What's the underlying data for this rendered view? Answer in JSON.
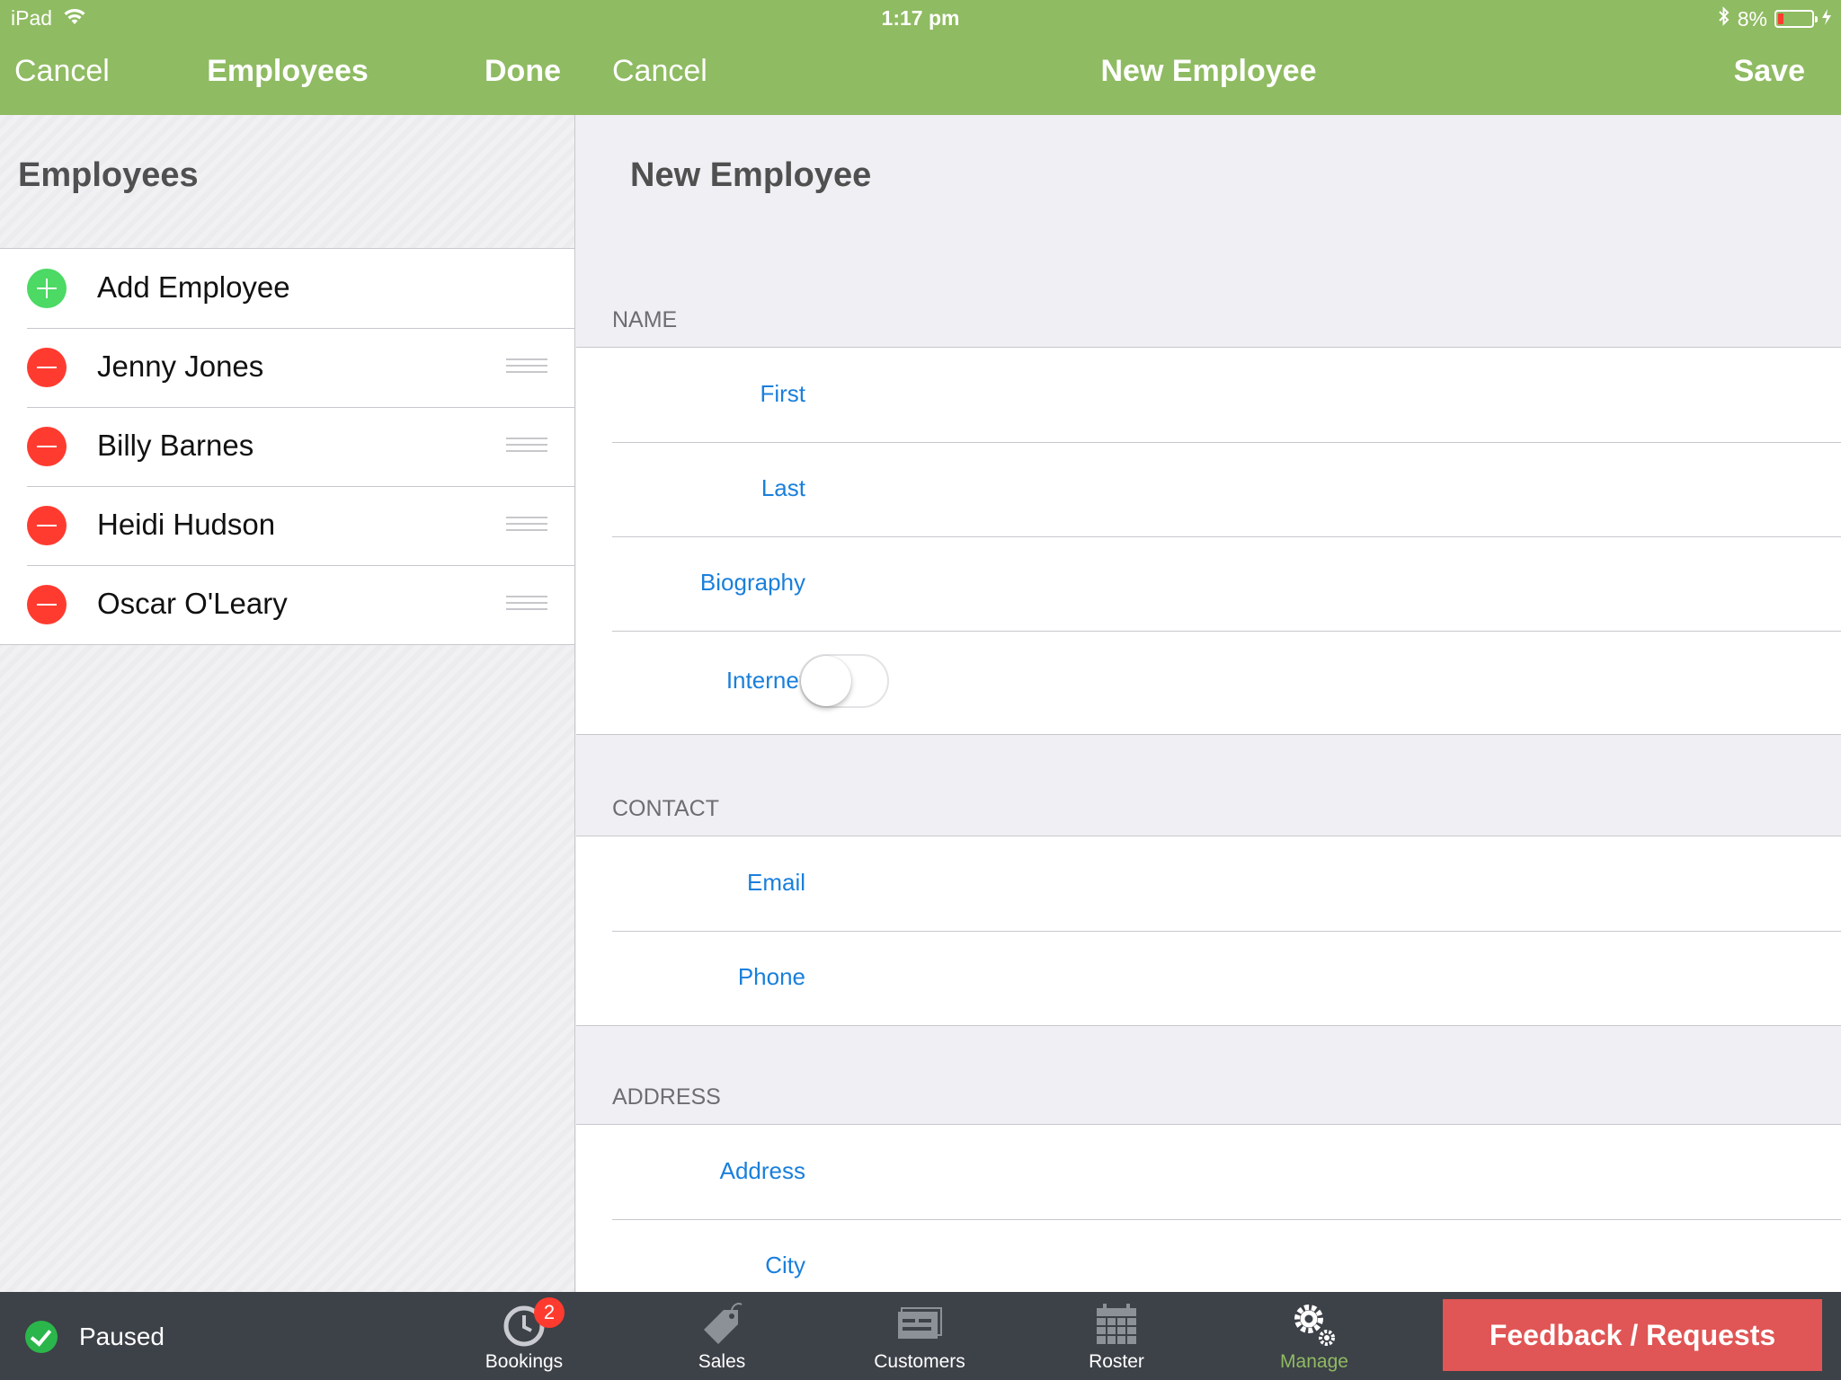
{
  "status_bar": {
    "device": "iPad",
    "time": "1:17 pm",
    "battery_percent": "8%",
    "battery_level": 0.08
  },
  "left_nav": {
    "cancel_label": "Cancel",
    "title": "Employees",
    "done_label": "Done"
  },
  "right_nav": {
    "cancel_label": "Cancel",
    "title": "New Employee",
    "save_label": "Save"
  },
  "employees_panel": {
    "heading": "Employees",
    "add_label": "Add Employee",
    "employees": [
      "Jenny Jones",
      "Billy Barnes",
      "Heidi Hudson",
      "Oscar O'Leary"
    ]
  },
  "form": {
    "heading": "New Employee",
    "sections": {
      "name": {
        "label": "NAME",
        "first": "First",
        "last": "Last",
        "biography": "Biography",
        "internet": "Internet",
        "internet_on": false
      },
      "contact": {
        "label": "CONTACT",
        "email": "Email",
        "phone": "Phone"
      },
      "address": {
        "label": "ADDRESS",
        "address": "Address",
        "city": "City"
      }
    }
  },
  "bottom_bar": {
    "status_label": "Paused",
    "tabs": {
      "bookings": {
        "label": "Bookings",
        "badge": "2"
      },
      "sales": {
        "label": "Sales"
      },
      "customers": {
        "label": "Customers"
      },
      "roster": {
        "label": "Roster"
      },
      "manage": {
        "label": "Manage"
      }
    },
    "feedback_label": "Feedback / Requests"
  },
  "colors": {
    "nav_green": "#8fbb62",
    "add_green": "#4cd964",
    "delete_red": "#ff3b30",
    "field_label_blue": "#1a7fdb",
    "bottom_bar": "#3d4148",
    "feedback_red": "#e05555"
  }
}
